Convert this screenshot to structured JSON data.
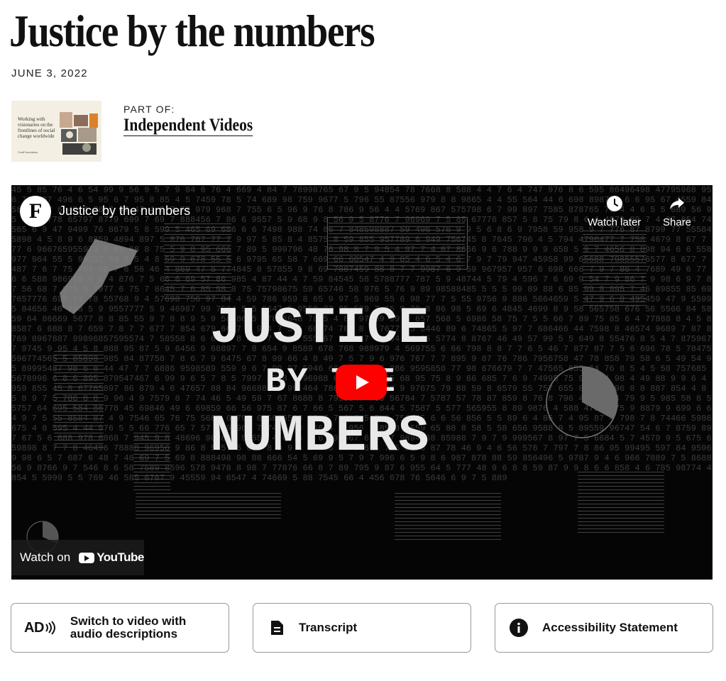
{
  "article": {
    "title": "Justice by the numbers",
    "date": "JUNE 3, 2022"
  },
  "part_of": {
    "label": "PART OF:",
    "series": "Independent Videos",
    "thumb_text": "Working with visionaries on the frontlines of social change worldwide",
    "thumb_footer": "FordFoundation"
  },
  "video": {
    "channel_initial": "F",
    "title": "Justice by the numbers",
    "watch_later": "Watch later",
    "share": "Share",
    "thumb_line1": "JUSTICE",
    "thumb_line2": "BY THE",
    "thumb_line3": "NUMBERS",
    "watch_on": "Watch on",
    "youtube": "YouTube",
    "play_color": "#ff0000"
  },
  "actions": {
    "audio_desc_icon": "AD",
    "audio_desc": "Switch to video with audio descriptions",
    "transcript": "Transcript",
    "accessibility": "Accessibility Statement"
  },
  "icons": {
    "clock": "clock-icon",
    "share": "share-arrow-icon",
    "document": "document-icon",
    "info": "info-icon",
    "audio_description": "audio-description-icon"
  }
}
